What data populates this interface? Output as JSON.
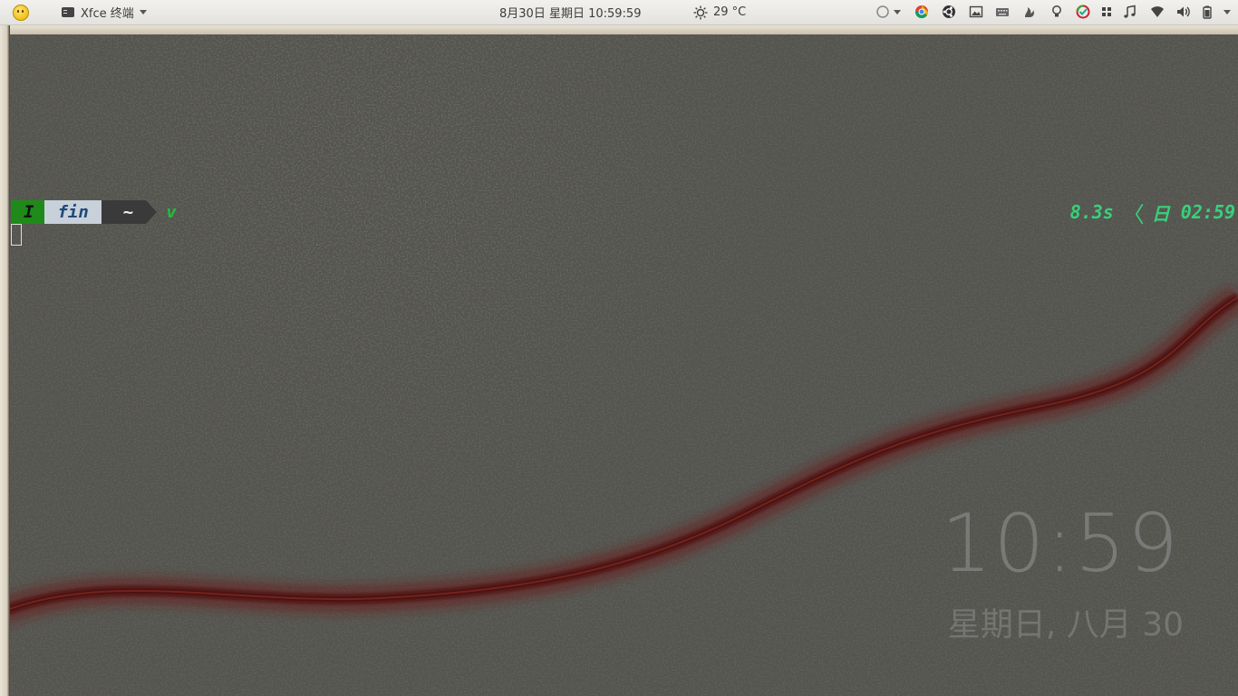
{
  "panel": {
    "app_menu_title": "Xfce 终端",
    "datetime": "8月30日 星期日 10:59:59",
    "weather": "29 °C",
    "tray_icons": [
      "power-status-icon",
      "chrome-icon",
      "ubuntu-icon",
      "image-viewer-icon",
      "keyboard-icon",
      "flame-icon",
      "lightbulb-icon",
      "sync-check-icon",
      "apps-grid-icon",
      "music-icon",
      "wifi-icon",
      "volume-icon",
      "battery-icon"
    ]
  },
  "terminal": {
    "mode": "I",
    "user": "fin",
    "dir": "~",
    "prompt_char": "v",
    "duration": "8.3s",
    "day": "日",
    "time": "02:59"
  },
  "desktop_clock": {
    "time": "10:59",
    "date": "星期日, 八月 30"
  },
  "colors": {
    "panel_bg": "#ece9e3",
    "mode_segment": "#1f8a1a",
    "user_segment": "#c8d1da",
    "dir_segment": "#3a3a3a",
    "right_prompt": "#36d27a"
  }
}
